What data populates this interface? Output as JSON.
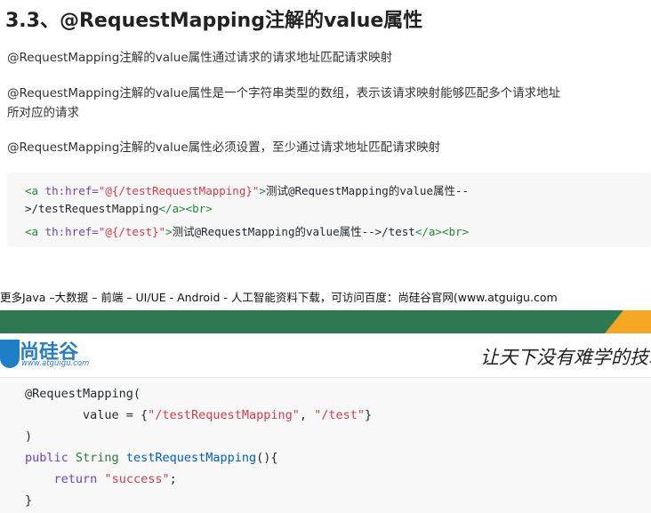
{
  "heading": "3.3、@RequestMapping注解的value属性",
  "paragraphs": [
    "@RequestMapping注解的value属性通过请求的请求地址匹配请求映射",
    "@RequestMapping注解的value属性是一个字符串类型的数组，表示该请求映射能够匹配多个请求地址",
    "所对应的请求",
    "@RequestMapping注解的value属性必须设置，至少通过请求地址匹配请求映射"
  ],
  "code_block_1": {
    "line1": {
      "open": "<a ",
      "attr": "th:href=",
      "val": "\"@{/testRequestMapping}\"",
      "close": ">",
      "text": "测试@RequestMapping的value属性--"
    },
    "line2": {
      "text": ">/testRequestMapping",
      "end": "</a><br>"
    },
    "line3": {
      "open": "<a ",
      "attr": "th:href=",
      "val": "\"@{/test}\"",
      "close": ">",
      "text": "测试@RequestMapping的value属性-->/test",
      "end": "</a><br>"
    }
  },
  "footer": {
    "text": "更多Java –大数据 – 前端 – UI/UE - Android - 人工智能资料下载，可访问百度：尚硅谷官网(www.atguigu.com",
    "logo_cn": "尚硅谷",
    "logo_url": "www.atguigu.com",
    "slogan": "让天下没有难学的技术",
    "band_color": "#2d7a52",
    "accent_color": "#f5a623"
  },
  "code_block_2": {
    "l1": "@RequestMapping(",
    "l2_pre": "        value = {",
    "l2_s1": "\"/testRequestMapping\"",
    "l2_mid": ", ",
    "l2_s2": "\"/test\"",
    "l2_post": "}",
    "l3": ")",
    "l4_kw": "public",
    "l4_type": "String",
    "l4_fn": "testRequestMapping",
    "l4_post": "(){",
    "l5_kw": "return",
    "l5_str": "\"success\"",
    "l5_post": ";",
    "l6": "}"
  }
}
